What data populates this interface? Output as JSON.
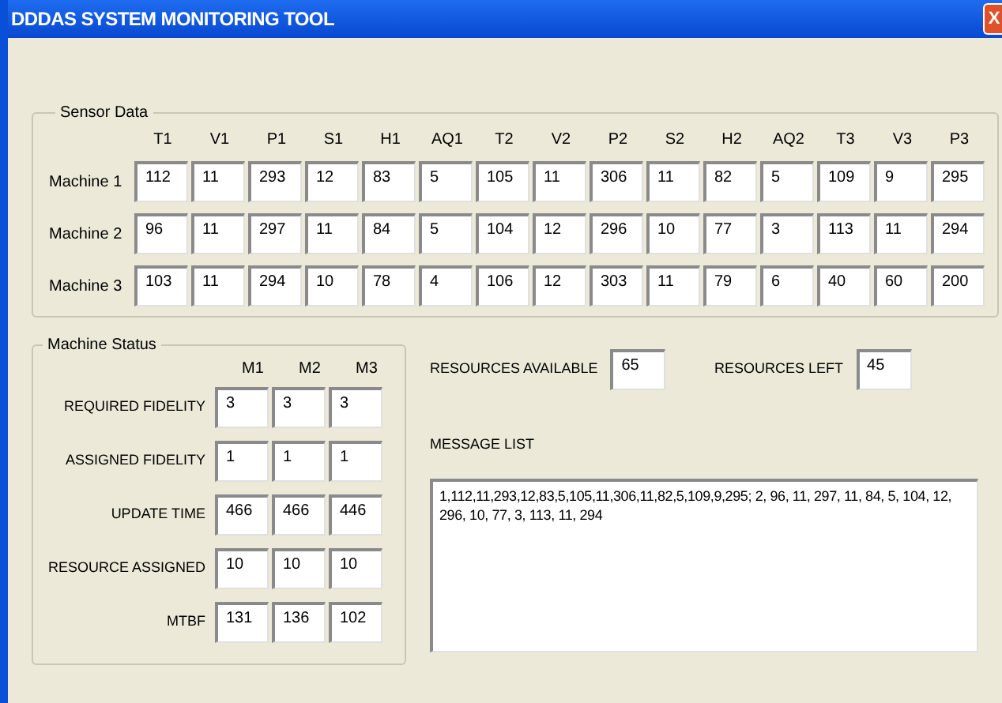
{
  "window": {
    "title": "DDDAS SYSTEM MONITORING TOOL",
    "close": "X"
  },
  "sensor_data": {
    "title": "Sensor Data",
    "columns": [
      "T1",
      "V1",
      "P1",
      "S1",
      "H1",
      "AQ1",
      "T2",
      "V2",
      "P2",
      "S2",
      "H2",
      "AQ2",
      "T3",
      "V3",
      "P3"
    ],
    "rows": [
      {
        "label": "Machine 1",
        "values": [
          "112",
          "11",
          "293",
          "12",
          "83",
          "5",
          "105",
          "11",
          "306",
          "11",
          "82",
          "5",
          "109",
          "9",
          "295"
        ]
      },
      {
        "label": "Machine 2",
        "values": [
          "96",
          "11",
          "297",
          "11",
          "84",
          "5",
          "104",
          "12",
          "296",
          "10",
          "77",
          "3",
          "113",
          "11",
          "294"
        ]
      },
      {
        "label": "Machine 3",
        "values": [
          "103",
          "11",
          "294",
          "10",
          "78",
          "4",
          "106",
          "12",
          "303",
          "11",
          "79",
          "6",
          "40",
          "60",
          "200"
        ]
      }
    ]
  },
  "machine_status": {
    "title": "Machine Status",
    "columns": [
      "M1",
      "M2",
      "M3"
    ],
    "rows": [
      {
        "label": "REQUIRED FIDELITY",
        "values": [
          "3",
          "3",
          "3"
        ]
      },
      {
        "label": "ASSIGNED FIDELITY",
        "values": [
          "1",
          "1",
          "1"
        ]
      },
      {
        "label": "UPDATE TIME",
        "values": [
          "466",
          "466",
          "446"
        ]
      },
      {
        "label": "RESOURCE ASSIGNED",
        "values": [
          "10",
          "10",
          "10"
        ]
      },
      {
        "label": "MTBF",
        "values": [
          "131",
          "136",
          "102"
        ]
      }
    ]
  },
  "resources": [
    {
      "label": "RESOURCES AVAILABLE",
      "value": "65"
    },
    {
      "label": "RESOURCES LEFT",
      "value": "45"
    }
  ],
  "message_list": {
    "label": "MESSAGE LIST",
    "value": "1,112,11,293,12,83,5,105,11,306,11,82,5,109,9,295; 2, 96, 11, 297, 11, 84, 5, 104, 12, 296, 10, 77, 3, 113, 11, 294"
  }
}
